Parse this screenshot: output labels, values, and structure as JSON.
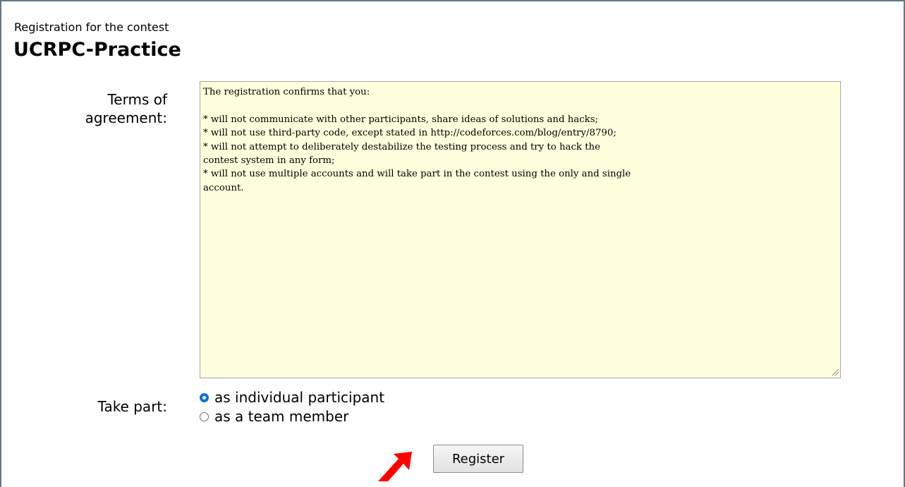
{
  "header": {
    "subtitle": "Registration for the contest",
    "title": "UCRPC-Practice"
  },
  "form": {
    "terms_label_line1": "Terms of",
    "terms_label_line2": "agreement:",
    "terms_text": "The registration confirms that you:\n\n* will not communicate with other participants, share ideas of solutions and hacks;\n* will not use third-party code, except stated in http://codeforces.com/blog/entry/8790;\n* will not attempt to deliberately destabilize the testing process and try to hack the\ncontest system in any form;\n* will not use multiple accounts and will take part in the contest using the only and single\naccount.",
    "take_part_label": "Take part:",
    "options": [
      {
        "label": "as individual participant",
        "checked": true
      },
      {
        "label": "as a team member",
        "checked": false
      }
    ],
    "register_label": "Register"
  },
  "colors": {
    "terms_background": "#ffffdd",
    "frame_border": "#5e7a86",
    "radio_accent": "#0b6fe0",
    "annotation_arrow": "#ff0000"
  },
  "icons": [
    "resize-grip-icon",
    "red-arrow-icon"
  ]
}
